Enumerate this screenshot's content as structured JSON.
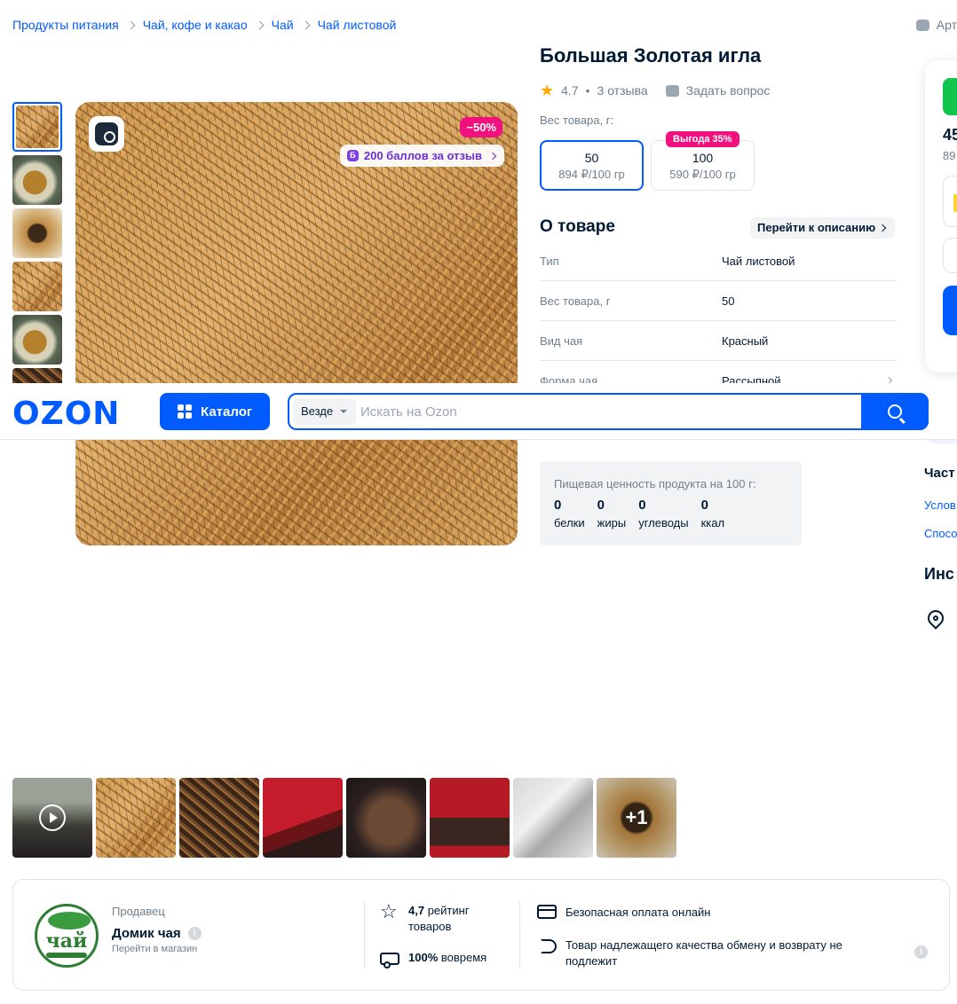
{
  "breadcrumbs": [
    "Продукты питания",
    "Чай, кофе и какао",
    "Чай",
    "Чай листовой"
  ],
  "article_label": "Арт",
  "product": {
    "title": "Большая Золотая игла",
    "rating": "4.7",
    "reviews": "3 отзыва",
    "ask_question": "Задать вопрос",
    "discount_badge": "−50%",
    "bonus_badge": "200 баллов за отзыв",
    "bonus_icon_letter": "Б"
  },
  "weight": {
    "label": "Вес товара, г:",
    "options": [
      {
        "weight": "50",
        "price": "894 ₽/100 гр",
        "selected": true
      },
      {
        "weight": "100",
        "price": "590 ₽/100 гр",
        "tag": "Выгода 35%"
      }
    ]
  },
  "about": {
    "title": "О товаре",
    "goto_description": "Перейти к описанию",
    "specs": [
      {
        "key": "Тип",
        "value": "Чай листовой"
      },
      {
        "key": "Вес товара, г",
        "value": "50"
      },
      {
        "key": "Вид чая",
        "value": "Красный"
      },
      {
        "key": "Форма чая",
        "value": "Рассыпной"
      }
    ]
  },
  "nutrition": {
    "title": "Пищевая ценность продукта на 100 г:",
    "items": [
      {
        "value": "0",
        "label": "белки"
      },
      {
        "value": "0",
        "label": "жиры"
      },
      {
        "value": "0",
        "label": "углеводы"
      },
      {
        "value": "0",
        "label": "ккал"
      }
    ]
  },
  "buy_panel": {
    "price_partial": "45",
    "price2_partial": "89"
  },
  "right_column": {
    "faq_partial": "Част",
    "link1_partial": "Услов",
    "link2_partial": "Спосо",
    "info_partial": "Инс"
  },
  "header": {
    "logo": "OZON",
    "catalog": "Каталог",
    "scope": "Везде",
    "search_placeholder": "Искать на Ozon"
  },
  "review_photos": {
    "more_label": "+1"
  },
  "seller": {
    "label": "Продавец",
    "name": "Домик чая",
    "store_link": "Перейти в магазин",
    "logo_text": "чай",
    "rating_value": "4,7",
    "rating_text": "рейтинг товаров",
    "ontime_value": "100%",
    "ontime_text": "вовремя",
    "safe_payment": "Безопасная оплата онлайн",
    "return_policy": "Товар надлежащего качества обмену и возврату не подлежит"
  },
  "colors": {
    "accent": "#005bff",
    "discount": "#f1117e",
    "bonus": "#6b2fd6",
    "star": "#ffa800"
  }
}
